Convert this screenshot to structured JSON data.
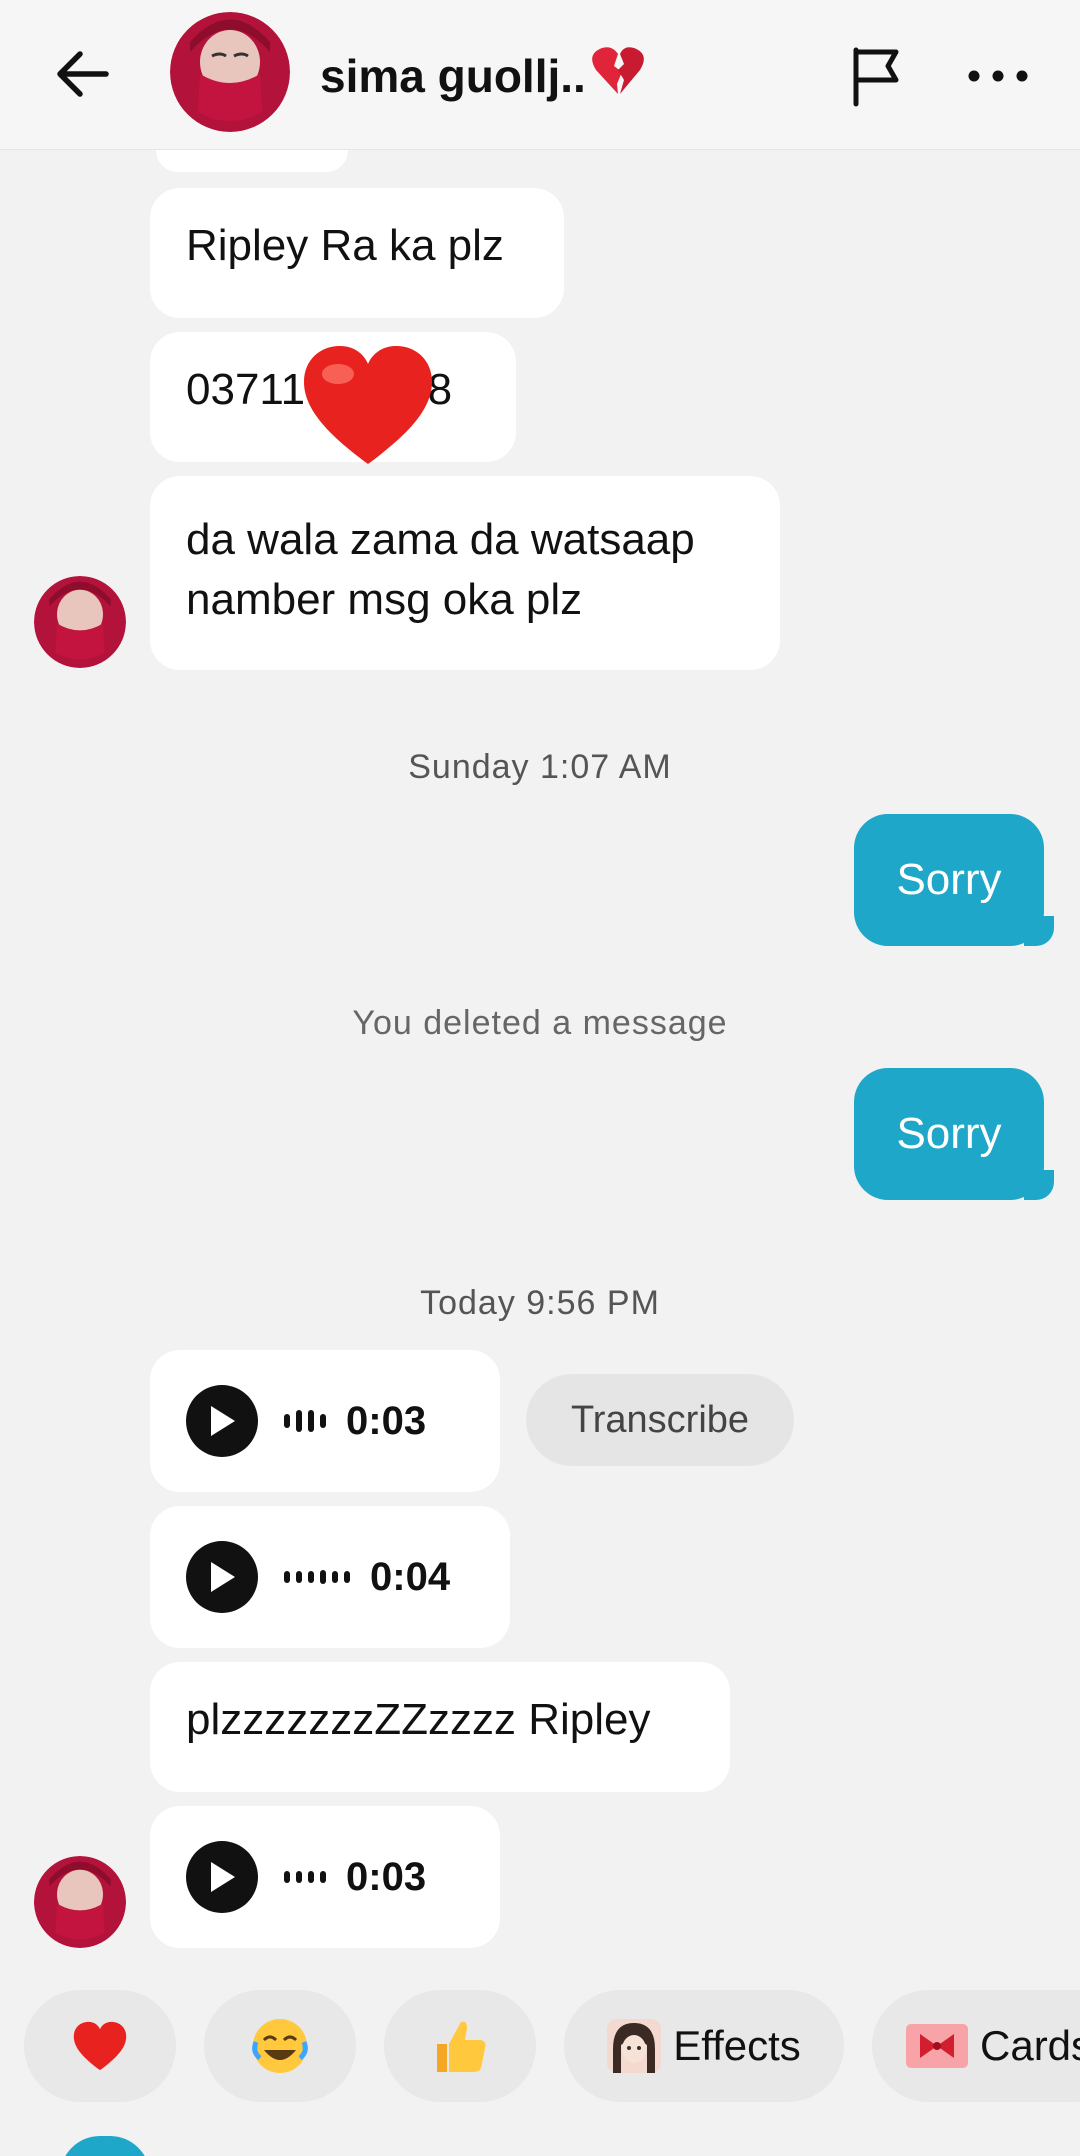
{
  "header": {
    "contact_name": "sima guollj..",
    "back_icon": "arrow-left-icon",
    "report_icon": "flag-icon",
    "more_icon": "more-horizontal-icon"
  },
  "messages": {
    "m1": "Ripley Ra ka plz",
    "m2_left": "03711",
    "m2_right": "88",
    "m3": "da wala zama da watsaap namber msg oka plz",
    "ts1": "Sunday 1:07 AM",
    "sent1": "Sorry",
    "deleted": "You deleted a message",
    "sent2": "Sorry",
    "ts2": "Today 9:56 PM",
    "voice1_duration": "0:03",
    "transcribe_label": "Transcribe",
    "voice2_duration": "0:04",
    "m4": "plzzzzzzzZZzzzz Ripley",
    "voice3_duration": "0:03"
  },
  "quick_bar": {
    "heart": "❤️",
    "laugh": "😂",
    "thumbs": "👍",
    "effects_label": "Effects",
    "cards_label": "Cards"
  },
  "colors": {
    "sent_bubble": "#1ea7c9",
    "background": "#f2f2f2",
    "received_bubble": "#ffffff"
  }
}
